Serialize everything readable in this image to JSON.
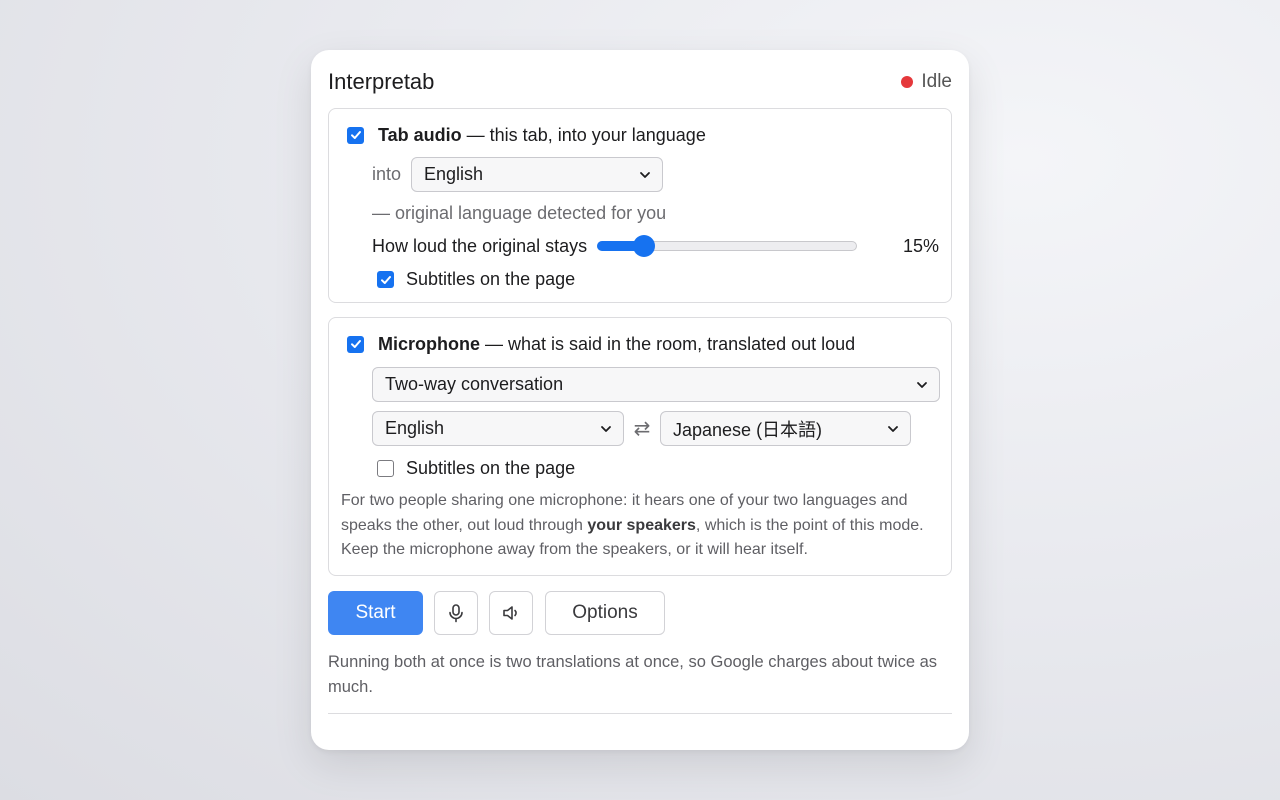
{
  "app": {
    "title": "Interpretab",
    "status": {
      "label": "Idle",
      "color": "#e5383b"
    }
  },
  "tab_audio": {
    "enabled": true,
    "title": "Tab audio",
    "subtitle": " — this tab, into your language",
    "into_label": "into",
    "target_language": "English",
    "detect_note": "— original language detected for you",
    "original_volume_label": "How loud the original stays",
    "original_volume_value": "15%",
    "original_volume_fraction": 0.15,
    "subtitles_enabled": true,
    "subtitles_label": "Subtitles on the page"
  },
  "microphone": {
    "enabled": true,
    "title": "Microphone",
    "subtitle": " — what is said in the room, translated out loud",
    "mode": "Two-way conversation",
    "language_a": "English",
    "swap_symbol": "⇄",
    "language_b": "Japanese (日本語)",
    "subtitles_enabled": false,
    "subtitles_label": "Subtitles on the page",
    "description_part1": "For two people sharing one microphone: it hears one of your two languages and speaks the other, out loud through ",
    "description_bold": "your speakers",
    "description_part2": ", which is the point of this mode. Keep the microphone away from the speakers, or it will hear itself."
  },
  "actions": {
    "start_label": "Start",
    "mic_icon": "microphone-icon",
    "speaker_icon": "speaker-icon",
    "options_label": "Options"
  },
  "footnote": "Running both at once is two translations at once, so Google charges about twice as much.",
  "colors": {
    "accent": "#1672f0",
    "primary_button": "#3f86f2"
  }
}
